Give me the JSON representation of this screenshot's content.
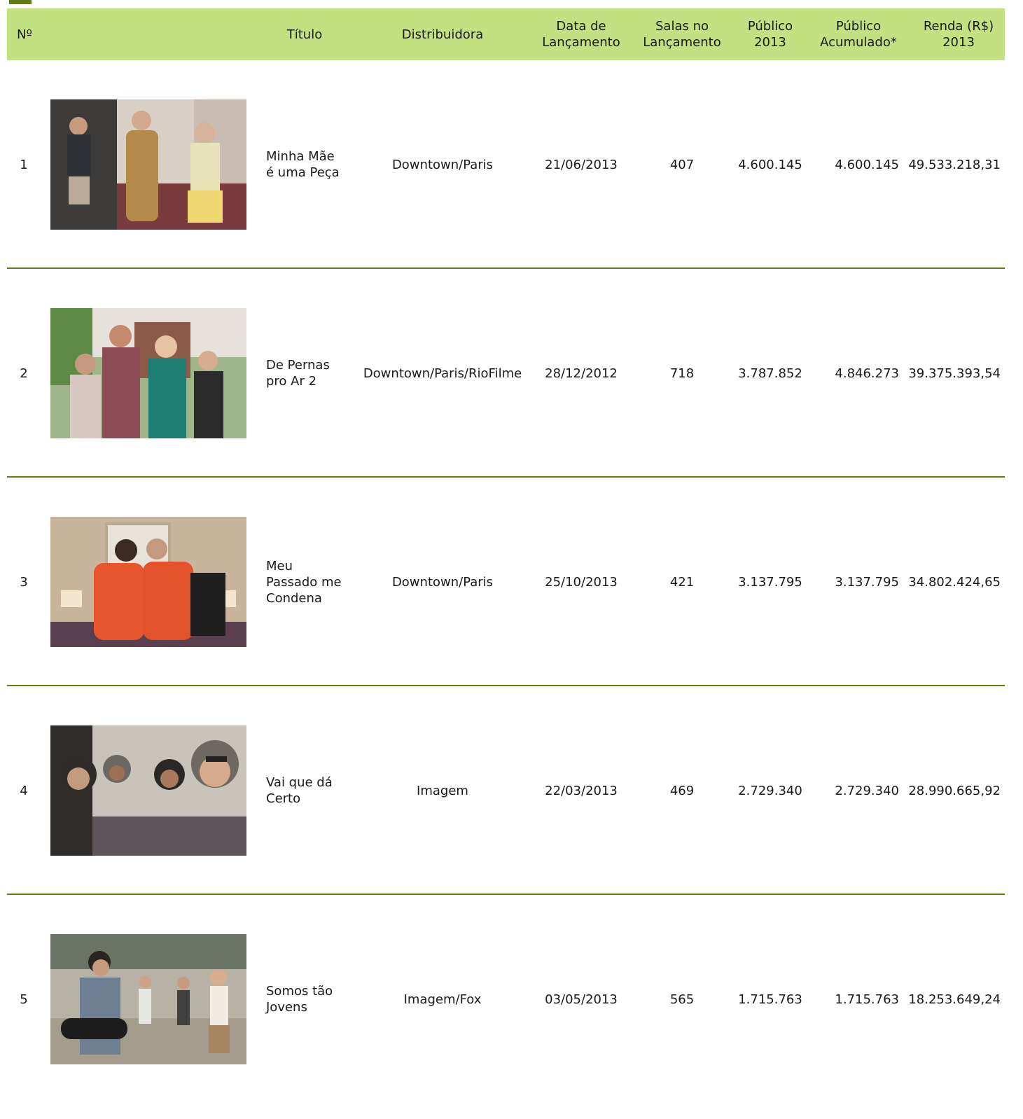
{
  "header": {
    "num": "Nº",
    "titulo": "Título",
    "distribuidora": "Distribuidora",
    "data_lancamento": "Data de\nLançamento",
    "salas": "Salas no\nLançamento",
    "publico_2013": "Público\n2013",
    "publico_acumulado": "Público\nAcumulado*",
    "renda": "Renda (R$)\n2013"
  },
  "rows": [
    {
      "num": "1",
      "image": "film-still-minha-mae-e-uma-peca",
      "titulo": "Minha Mãe\né uma Peça",
      "distribuidora": "Downtown/Paris",
      "data": "21/06/2013",
      "salas": "407",
      "publico_2013": "4.600.145",
      "publico_acumulado": "4.600.145",
      "renda": "49.533.218,31"
    },
    {
      "num": "2",
      "image": "film-still-de-pernas-pro-ar-2",
      "titulo": "De Pernas\npro Ar 2",
      "distribuidora": "Downtown/Paris/RioFilme",
      "data": "28/12/2012",
      "salas": "718",
      "publico_2013": "3.787.852",
      "publico_acumulado": "4.846.273",
      "renda": "39.375.393,54"
    },
    {
      "num": "3",
      "image": "film-still-meu-passado-me-condena",
      "titulo": "Meu\nPassado me\nCondena",
      "distribuidora": "Downtown/Paris",
      "data": "25/10/2013",
      "salas": "421",
      "publico_2013": "3.137.795",
      "publico_acumulado": "3.137.795",
      "renda": "34.802.424,65"
    },
    {
      "num": "4",
      "image": "film-still-vai-que-da-certo",
      "titulo": "Vai que dá\nCerto",
      "distribuidora": "Imagem",
      "data": "22/03/2013",
      "salas": "469",
      "publico_2013": "2.729.340",
      "publico_acumulado": "2.729.340",
      "renda": "28.990.665,92"
    },
    {
      "num": "5",
      "image": "film-still-somos-tao-jovens",
      "titulo": "Somos tão\nJovens",
      "distribuidora": "Imagem/Fox",
      "data": "03/05/2013",
      "salas": "565",
      "publico_2013": "1.715.763",
      "publico_acumulado": "1.715.763",
      "renda": "18.253.649,24"
    }
  ],
  "colors": {
    "header_bg": "#c4e182",
    "rule": "#5f7d14",
    "accent": "#5f7d14"
  }
}
